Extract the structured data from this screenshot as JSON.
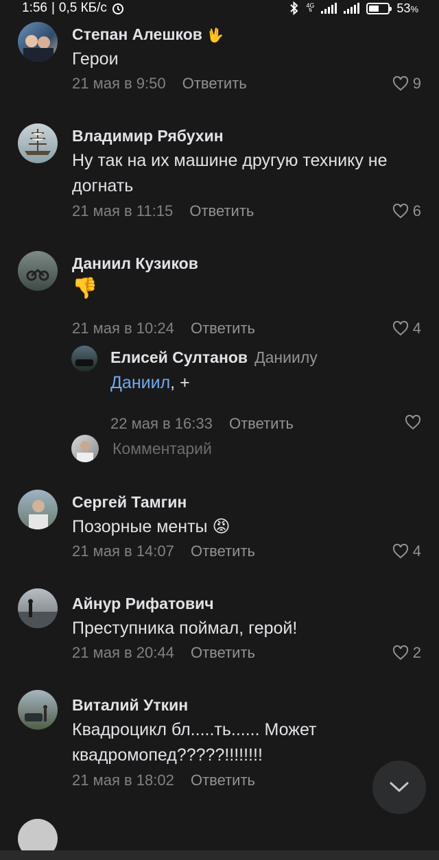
{
  "status_bar": {
    "time": "1:56",
    "speed": "0,5 КБ/с",
    "network": "4G",
    "battery_text": "53",
    "battery_unit": "%",
    "battery_level": 0.53
  },
  "comments": [
    {
      "author": "Степан Алешков",
      "text": "Герои",
      "date": "21 мая в 9:50",
      "reply": "Ответить",
      "likes": "9"
    },
    {
      "author": "Владимир Рябухин",
      "text": "Ну так на их машине другую технику не догнать",
      "date": "21 мая в 11:15",
      "reply": "Ответить",
      "likes": "6"
    },
    {
      "author": "Даниил Кузиков",
      "text": "👎",
      "date": "21 мая в 10:24",
      "reply": "Ответить",
      "likes": "4"
    },
    {
      "author": "Сергей Тамгин",
      "text": "Позорные менты 😡",
      "date": "21 мая в 14:07",
      "reply": "Ответить",
      "likes": "4"
    },
    {
      "author": "Айнур Рифатович",
      "text": "Преступника поймал, герой!",
      "date": "21 мая в 20:44",
      "reply": "Ответить",
      "likes": "2"
    },
    {
      "author": "Виталий Уткин",
      "text": "Квадроцикл бл.....ть...... Может квадромопед?????!!!!!!!!",
      "date": "21 мая в 18:02",
      "reply": "Ответить",
      "likes": ""
    }
  ],
  "reply_thread": {
    "author": "Елисей Султанов",
    "reply_to": "Даниилу",
    "mention": "Даниил",
    "text_after": ", +",
    "date": "22 мая в 16:33",
    "reply": "Ответить"
  },
  "compose": {
    "placeholder": "Комментарий"
  },
  "icons": {
    "like": "heart-icon",
    "scroll_down": "chevron-down-icon"
  },
  "colors": {
    "background": "#19191a",
    "mention": "#71aaeb",
    "muted": "#828282"
  }
}
